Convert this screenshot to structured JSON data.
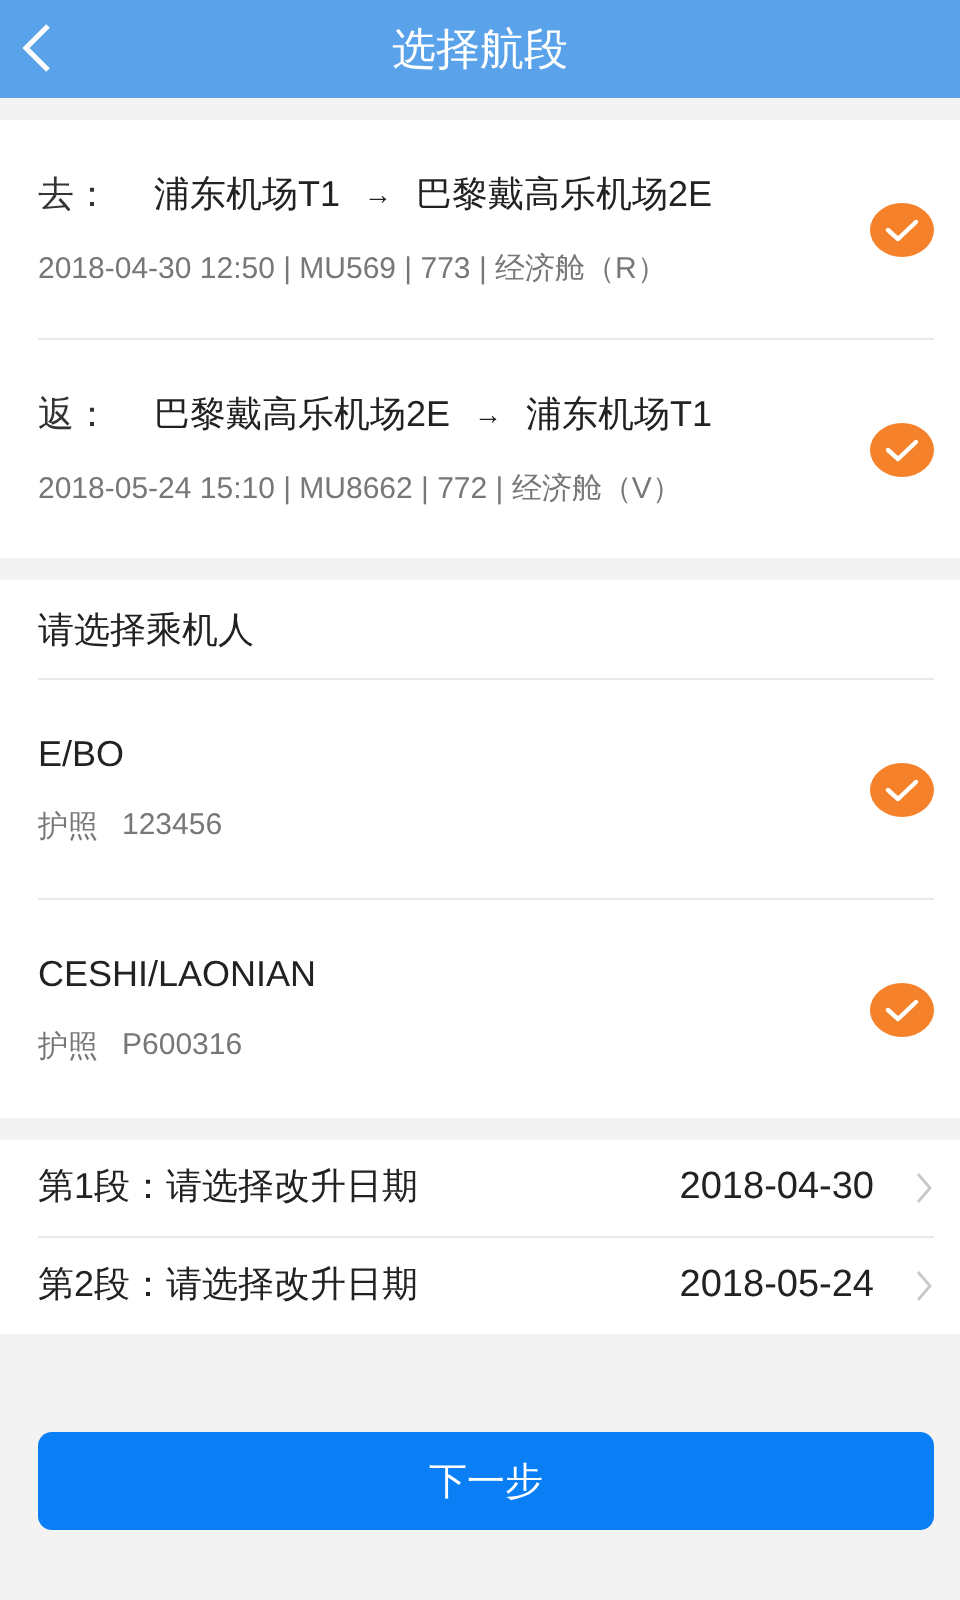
{
  "header": {
    "title": "选择航段"
  },
  "segments": [
    {
      "direction": "去：",
      "from": "浦东机场T1",
      "arrow": "→",
      "to": "巴黎戴高乐机场2E",
      "details": "2018-04-30 12:50 | MU569 | 773 | 经济舱（R）",
      "checked": true
    },
    {
      "direction": "返：",
      "from": "巴黎戴高乐机场2E",
      "arrow": "→",
      "to": "浦东机场T1",
      "details": "2018-05-24 15:10 | MU8662 | 772 | 经济舱（V）",
      "checked": true
    }
  ],
  "passengers": {
    "heading": "请选择乘机人",
    "items": [
      {
        "name": "E/BO",
        "id_type": "护照",
        "id_number": "123456",
        "checked": true
      },
      {
        "name": "CESHI/LAONIAN",
        "id_type": "护照",
        "id_number": "P600316",
        "checked": true
      }
    ]
  },
  "date_rows": [
    {
      "label": "第1段：请选择改升日期",
      "value": "2018-04-30"
    },
    {
      "label": "第2段：请选择改升日期",
      "value": "2018-05-24"
    }
  ],
  "next_button": "下一步"
}
